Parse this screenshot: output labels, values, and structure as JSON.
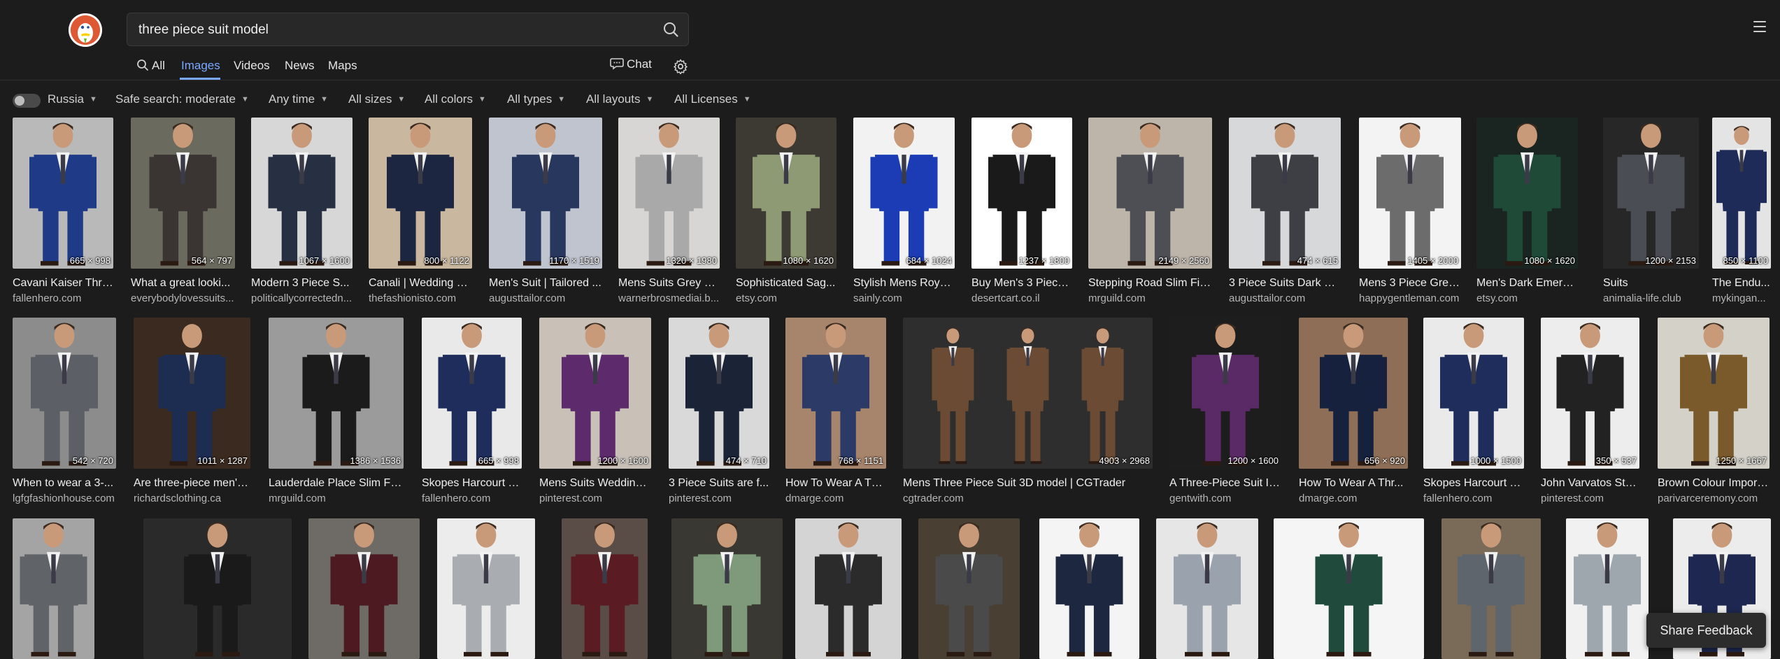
{
  "search": {
    "query": "three piece suit model"
  },
  "tabs": [
    {
      "label": "All",
      "active": false
    },
    {
      "label": "Images",
      "active": true
    },
    {
      "label": "Videos",
      "active": false
    },
    {
      "label": "News",
      "active": false
    },
    {
      "label": "Maps",
      "active": false
    }
  ],
  "chat_label": "Chat",
  "filters": {
    "region": "Russia",
    "safe": "Safe search: moderate",
    "time": "Any time",
    "size": "All sizes",
    "color": "All colors",
    "type": "All types",
    "layout": "All layouts",
    "license": "All Licenses"
  },
  "share_label": "Share Feedback",
  "rows": [
    [
      {
        "title": "Cavani Kaiser Thre...",
        "source": "fallenhero.com",
        "dims": "665 × 998",
        "bg": "#b9b9b9",
        "suit": "#1f3a86",
        "light": true
      },
      {
        "title": "What a great looki...",
        "source": "everybodylovessuits...",
        "dims": "564 × 797",
        "bg": "#6b6a5e",
        "suit": "#3a3432",
        "light": false
      },
      {
        "title": "Modern 3 Piece S...",
        "source": "politicallycorrectedn...",
        "dims": "1067 × 1600",
        "bg": "#d7d7d7",
        "suit": "#273043",
        "light": true
      },
      {
        "title": "Canali | Wedding S...",
        "source": "thefashionisto.com",
        "dims": "800 × 1122",
        "bg": "#c9b79f",
        "suit": "#1c2640",
        "light": true
      },
      {
        "title": "Men's Suit | Tailored ...",
        "source": "augusttailor.com",
        "dims": "1170 × 1519",
        "bg": "#bfc4cf",
        "suit": "#28375e",
        "light": true
      },
      {
        "title": "Mens Suits Grey 3 ...",
        "source": "warnerbrosmediai.b...",
        "dims": "1320 × 1980",
        "bg": "#d8d6d4",
        "suit": "#a9a9a9",
        "light": true
      },
      {
        "title": "Sophisticated Sag...",
        "source": "etsy.com",
        "dims": "1080 × 1620",
        "bg": "#3d3a34",
        "suit": "#8e9a74",
        "light": false
      },
      {
        "title": "Stylish Mens Royal...",
        "source": "sainly.com",
        "dims": "684 × 1024",
        "bg": "#f2f2f2",
        "suit": "#1b3cb5",
        "light": true
      },
      {
        "title": "Buy Men's 3 Piece ...",
        "source": "desertcart.co.il",
        "dims": "1237 × 1800",
        "bg": "#ffffff",
        "suit": "#1a1a1a",
        "light": true
      },
      {
        "title": "Stepping Road Slim Fit ...",
        "source": "mrguild.com",
        "dims": "2149 × 2560",
        "bg": "#bdb4aa",
        "suit": "#4d4f55",
        "light": true
      },
      {
        "title": "3 Piece Suits Dark Gr...",
        "source": "augusttailor.com",
        "dims": "474 × 615",
        "bg": "#d7d8da",
        "suit": "#3e3f44",
        "light": true
      },
      {
        "title": "Mens 3 Piece Grey...",
        "source": "happygentleman.com",
        "dims": "1405 × 2000",
        "bg": "#f3f3f3",
        "suit": "#6c6c6c",
        "light": true
      },
      {
        "title": "Men's Dark Emeral...",
        "source": "etsy.com",
        "dims": "1080 × 1620",
        "bg": "#1a2420",
        "suit": "#1f4a38",
        "light": false
      },
      {
        "title": "Suits",
        "source": "animalia-life.club",
        "dims": "1200 × 2153",
        "bg": "#272727",
        "suit": "#4a4d53",
        "light": false
      },
      {
        "title": "The Endu...",
        "source": "mykingan...",
        "dims": "850 × 1100",
        "bg": "#e4e4e4",
        "suit": "#1e2b58",
        "light": true
      }
    ],
    [
      {
        "title": "When to wear a 3-...",
        "source": "lgfgfashionhouse.com",
        "dims": "542 × 720",
        "bg": "#8c8c8c",
        "suit": "#5c6066",
        "light": true
      },
      {
        "title": "Are three-piece men's...",
        "source": "richardsclothing.ca",
        "dims": "1011 × 1287",
        "bg": "#3a2a20",
        "suit": "#1d2d52",
        "light": false
      },
      {
        "title": "Lauderdale Place Slim Fit ...",
        "source": "mrguild.com",
        "dims": "1386 × 1536",
        "bg": "#9b9b9b",
        "suit": "#1b1b1b",
        "light": true
      },
      {
        "title": "Skopes Harcourt T...",
        "source": "fallenhero.com",
        "dims": "665 × 998",
        "bg": "#e9e9e9",
        "suit": "#1e2d5c",
        "light": true
      },
      {
        "title": "Mens Suits Wedding ...",
        "source": "pinterest.com",
        "dims": "1200 × 1600",
        "bg": "#c9c1b8",
        "suit": "#5d2b6c",
        "light": true
      },
      {
        "title": "3 Piece Suits are f...",
        "source": "pinterest.com",
        "dims": "474 × 710",
        "bg": "#d9d9d9",
        "suit": "#1b2436",
        "light": true
      },
      {
        "title": "How To Wear A Th...",
        "source": "dmarge.com",
        "dims": "768 × 1151",
        "bg": "#a7846c",
        "suit": "#2b3a66",
        "light": true
      },
      {
        "title": "Mens Three Piece Suit 3D model | CGTrader",
        "source": "cgtrader.com",
        "dims": "4903 × 2968",
        "bg": "#2e2e2e",
        "suit": "#6b4b33",
        "light": false
      },
      {
        "title": "A Three-Piece Suit Is...",
        "source": "gentwith.com",
        "dims": "1200 × 1600",
        "bg": "#1d1d1d",
        "suit": "#5a2a66",
        "light": false
      },
      {
        "title": "How To Wear A Thr...",
        "source": "dmarge.com",
        "dims": "656 × 920",
        "bg": "#8e6e56",
        "suit": "#16213e",
        "light": true
      },
      {
        "title": "Skopes Harcourt T...",
        "source": "fallenhero.com",
        "dims": "1000 × 1500",
        "bg": "#eaeaea",
        "suit": "#1e2d5c",
        "light": true
      },
      {
        "title": "John Varvatos Star...",
        "source": "pinterest.com",
        "dims": "350 × 537",
        "bg": "#ededed",
        "suit": "#222222",
        "light": true
      },
      {
        "title": "Brown Colour Import...",
        "source": "parivarceremony.com",
        "dims": "1250 × 1667",
        "bg": "#d4d2c8",
        "suit": "#7a5a2a",
        "light": true
      }
    ],
    [
      {
        "bg": "#a4a4a4",
        "suit": "#606468",
        "light": true
      },
      {
        "bg": "#2a2a2a",
        "suit": "#1a1a1a",
        "light": false
      },
      {
        "bg": "#6e6a66",
        "suit": "#4d1a22",
        "light": true
      },
      {
        "bg": "#ececec",
        "suit": "#a9adb2",
        "light": true
      },
      {
        "bg": "#5a4d48",
        "suit": "#5a1b22",
        "light": false
      },
      {
        "bg": "#3a3833",
        "suit": "#7f9a7a",
        "light": false
      },
      {
        "bg": "#d4d4d4",
        "suit": "#2b2b2b",
        "light": true
      },
      {
        "bg": "#4a3f33",
        "suit": "#4a4a4a",
        "light": false
      },
      {
        "bg": "#f4f4f4",
        "suit": "#1e2740",
        "light": true
      },
      {
        "bg": "#e6e6e6",
        "suit": "#9aa2ad",
        "light": true
      },
      {
        "bg": "#f5f5f5",
        "suit": "#1f4a3c",
        "light": true
      },
      {
        "bg": "#7a6a58",
        "suit": "#5f656c",
        "light": true
      },
      {
        "bg": "#f1f1f1",
        "suit": "#9ea6ae",
        "light": true
      },
      {
        "bg": "#ececec",
        "suit": "#1d2750",
        "light": true
      }
    ]
  ]
}
